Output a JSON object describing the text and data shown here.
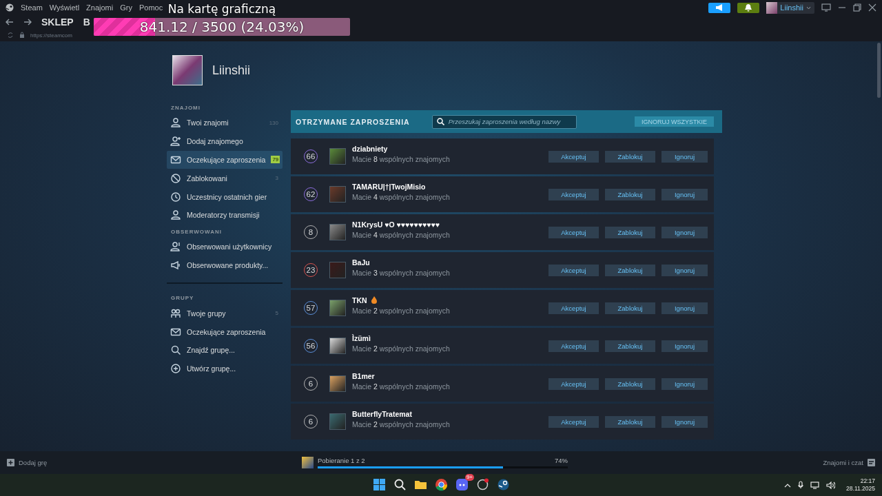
{
  "window": {
    "menu": [
      "Steam",
      "Wyświetl",
      "Znajomi",
      "Gry",
      "Pomoc"
    ],
    "user_name": "Liinshii"
  },
  "nav": {
    "tabs": [
      "SKLEP",
      "B"
    ],
    "url": "https://steamcom"
  },
  "overlay": {
    "title": "Na kartę graficzną",
    "reading": "841.12 / 3500 (24.03%)",
    "level": 0.2403
  },
  "profile": {
    "name": "Liinshii"
  },
  "sidebar": {
    "sections": [
      {
        "title": "ZNAJOMI",
        "items": [
          {
            "label": "Twoi znajomi",
            "count": "130",
            "highlighted": false,
            "selected": false
          },
          {
            "label": "Dodaj znajomego",
            "selected": false
          },
          {
            "label": "Oczekujące zaproszenia",
            "count": "79",
            "highlighted": true,
            "selected": true
          },
          {
            "label": "Zablokowani",
            "count": "3",
            "highlighted": false,
            "selected": false
          },
          {
            "label": "Uczestnicy ostatnich gier",
            "selected": false
          },
          {
            "label": "Moderatorzy transmisji",
            "selected": false
          }
        ]
      },
      {
        "title": "OBSERWOWANI",
        "items": [
          {
            "label": "Obserwowani użytkownicy",
            "selected": false
          },
          {
            "label": "Obserwowane produkty...",
            "selected": false
          }
        ]
      },
      {
        "title": "GRUPY",
        "items": [
          {
            "label": "Twoje grupy",
            "count": "5",
            "highlighted": false,
            "selected": false
          },
          {
            "label": "Oczekujące zaproszenia",
            "selected": false
          },
          {
            "label": "Znajdź grupę...",
            "selected": false
          },
          {
            "label": "Utwórz grupę...",
            "selected": false
          }
        ]
      }
    ]
  },
  "invites": {
    "title": "OTRZYMANE ZAPROSZENIA",
    "search": {
      "placeholder": "Przeszukaj zaproszenia według nazwy"
    },
    "ignore_all": "IGNORUJ WSZYSTKIE",
    "rows": [
      {
        "level": "66",
        "color": "#8c6ddc",
        "name": "dziabniety",
        "mutual": "Macie **8** wspólnych znajomych",
        "actions": [
          "Akceptuj",
          "Zablokuj",
          "Ignoruj"
        ]
      },
      {
        "level": "62",
        "color": "#8c6ddc",
        "name": "TAMARU|†|TwojMisio",
        "mutual": "Macie **4** wspólnych znajomych",
        "actions": [
          "Akceptuj",
          "Zablokuj",
          "Ignoruj"
        ]
      },
      {
        "level": "8",
        "color": "#b0b0b0",
        "name": "N1KrysU ♥O ♥♥♥♥♥♥♥♥♥♥",
        "mutual": "Macie **4** wspólnych znajomych",
        "actions": [
          "Akceptuj",
          "Zablokuj",
          "Ignoruj"
        ]
      },
      {
        "level": "23",
        "color": "#d9534f",
        "name": "BaJu",
        "mutual": "Macie **3** wspólnych znajomych",
        "actions": [
          "Akceptuj",
          "Zablokuj",
          "Ignoruj"
        ]
      },
      {
        "level": "57",
        "color": "#5b8fd9",
        "name": "TKN",
        "flame": true,
        "mutual": "Macie **2** wspólnych znajomych",
        "actions": [
          "Akceptuj",
          "Zablokuj",
          "Ignoruj"
        ]
      },
      {
        "level": "56",
        "color": "#5b8fd9",
        "name": "Ìzümì",
        "mutual": "Macie **2** wspólnych znajomych",
        "actions": [
          "Akceptuj",
          "Zablokuj",
          "Ignoruj"
        ]
      },
      {
        "level": "6",
        "color": "#b0b0b0",
        "name": "B1mer",
        "mutual": "Macie **2** wspólnych znajomych",
        "actions": [
          "Akceptuj",
          "Zablokuj",
          "Ignoruj"
        ]
      },
      {
        "level": "6",
        "color": "#b0b0b0",
        "name": "ButterflyTratemat",
        "mutual": "Macie **2** wspólnych znajomych",
        "actions": [
          "Akceptuj",
          "Zablokuj",
          "Ignoruj"
        ]
      }
    ]
  },
  "bottom_bar": {
    "add_game": "Dodaj grę",
    "download": {
      "label": "Pobieranie 1 z 2",
      "percent": "74%",
      "level": 0.74
    },
    "friends_chat": "Znajomi i czat"
  },
  "taskbar": {
    "discord_badge": "9+",
    "time": "22:17",
    "date": "28.11.2025"
  }
}
